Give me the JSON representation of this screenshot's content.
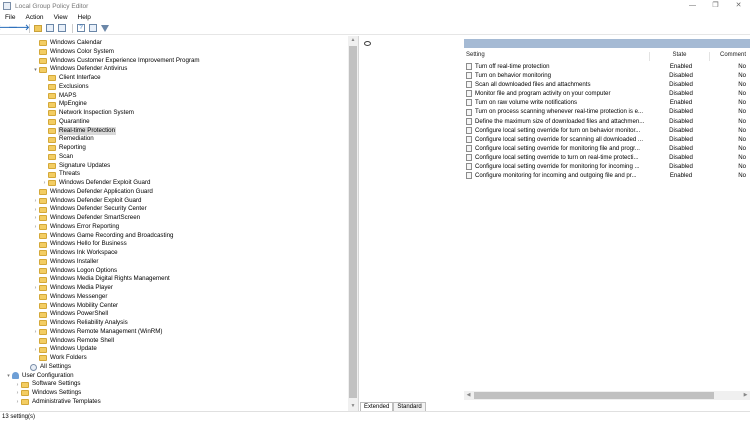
{
  "window": {
    "title": "Local Group Policy Editor",
    "controls": [
      "—",
      "❐",
      "✕"
    ]
  },
  "menu": [
    "File",
    "Action",
    "View",
    "Help"
  ],
  "toolbar": {
    "back": "🡐",
    "forward": "🡒"
  },
  "tree": {
    "items": [
      {
        "label": "Windows Calendar",
        "depth": 3,
        "expander": ""
      },
      {
        "label": "Windows Color System",
        "depth": 3,
        "expander": ""
      },
      {
        "label": "Windows Customer Experience Improvement Program",
        "depth": 3,
        "expander": ""
      },
      {
        "label": "Windows Defender Antivirus",
        "depth": 3,
        "expander": "▾"
      },
      {
        "label": "Client Interface",
        "depth": 4,
        "expander": ""
      },
      {
        "label": "Exclusions",
        "depth": 4,
        "expander": ""
      },
      {
        "label": "MAPS",
        "depth": 4,
        "expander": ""
      },
      {
        "label": "MpEngine",
        "depth": 4,
        "expander": ""
      },
      {
        "label": "Network Inspection System",
        "depth": 4,
        "expander": ""
      },
      {
        "label": "Quarantine",
        "depth": 4,
        "expander": ""
      },
      {
        "label": "Real-time Protection",
        "depth": 4,
        "expander": "",
        "selected": true
      },
      {
        "label": "Remediation",
        "depth": 4,
        "expander": ""
      },
      {
        "label": "Reporting",
        "depth": 4,
        "expander": ""
      },
      {
        "label": "Scan",
        "depth": 4,
        "expander": ""
      },
      {
        "label": "Signature Updates",
        "depth": 4,
        "expander": ""
      },
      {
        "label": "Threats",
        "depth": 4,
        "expander": ""
      },
      {
        "label": "Windows Defender Exploit Guard",
        "depth": 4,
        "expander": "›"
      },
      {
        "label": "Windows Defender Application Guard",
        "depth": 3,
        "expander": ""
      },
      {
        "label": "Windows Defender Exploit Guard",
        "depth": 3,
        "expander": "›"
      },
      {
        "label": "Windows Defender Security Center",
        "depth": 3,
        "expander": "›"
      },
      {
        "label": "Windows Defender SmartScreen",
        "depth": 3,
        "expander": "›"
      },
      {
        "label": "Windows Error Reporting",
        "depth": 3,
        "expander": "›"
      },
      {
        "label": "Windows Game Recording and Broadcasting",
        "depth": 3,
        "expander": ""
      },
      {
        "label": "Windows Hello for Business",
        "depth": 3,
        "expander": ""
      },
      {
        "label": "Windows Ink Workspace",
        "depth": 3,
        "expander": ""
      },
      {
        "label": "Windows Installer",
        "depth": 3,
        "expander": ""
      },
      {
        "label": "Windows Logon Options",
        "depth": 3,
        "expander": ""
      },
      {
        "label": "Windows Media Digital Rights Management",
        "depth": 3,
        "expander": ""
      },
      {
        "label": "Windows Media Player",
        "depth": 3,
        "expander": "›"
      },
      {
        "label": "Windows Messenger",
        "depth": 3,
        "expander": ""
      },
      {
        "label": "Windows Mobility Center",
        "depth": 3,
        "expander": ""
      },
      {
        "label": "Windows PowerShell",
        "depth": 3,
        "expander": ""
      },
      {
        "label": "Windows Reliability Analysis",
        "depth": 3,
        "expander": ""
      },
      {
        "label": "Windows Remote Management (WinRM)",
        "depth": 3,
        "expander": "›"
      },
      {
        "label": "Windows Remote Shell",
        "depth": 3,
        "expander": ""
      },
      {
        "label": "Windows Update",
        "depth": 3,
        "expander": "›"
      },
      {
        "label": "Work Folders",
        "depth": 3,
        "expander": ""
      },
      {
        "label": "All Settings",
        "depth": 2,
        "expander": "",
        "icon": "settings"
      },
      {
        "label": "User Configuration",
        "depth": 0,
        "expander": "▾",
        "icon": "user"
      },
      {
        "label": "Software Settings",
        "depth": 1,
        "expander": "›"
      },
      {
        "label": "Windows Settings",
        "depth": 1,
        "expander": "›"
      },
      {
        "label": "Administrative Templates",
        "depth": 1,
        "expander": "›"
      }
    ]
  },
  "details": {
    "columns": {
      "setting": "Setting",
      "state": "State",
      "comment": "Comment"
    },
    "rows": [
      {
        "setting": "Turn off real-time protection",
        "state": "Enabled",
        "comment": "No"
      },
      {
        "setting": "Turn on behavior monitoring",
        "state": "Disabled",
        "comment": "No"
      },
      {
        "setting": "Scan all downloaded files and attachments",
        "state": "Disabled",
        "comment": "No"
      },
      {
        "setting": "Monitor file and program activity on your computer",
        "state": "Disabled",
        "comment": "No"
      },
      {
        "setting": "Turn on raw volume write notifications",
        "state": "Enabled",
        "comment": "No"
      },
      {
        "setting": "Turn on process scanning whenever real-time protection is e...",
        "state": "Disabled",
        "comment": "No"
      },
      {
        "setting": "Define the maximum size of downloaded files and attachmen...",
        "state": "Disabled",
        "comment": "No"
      },
      {
        "setting": "Configure local setting override for turn on behavior monitor...",
        "state": "Disabled",
        "comment": "No"
      },
      {
        "setting": "Configure local setting override for scanning all downloaded ...",
        "state": "Disabled",
        "comment": "No"
      },
      {
        "setting": "Configure local setting override for monitoring file and progr...",
        "state": "Disabled",
        "comment": "No"
      },
      {
        "setting": "Configure local setting override to turn on real-time protecti...",
        "state": "Disabled",
        "comment": "No"
      },
      {
        "setting": "Configure local setting override for monitoring for incoming ...",
        "state": "Disabled",
        "comment": "No"
      },
      {
        "setting": "Configure monitoring for incoming and outgoing file and pr...",
        "state": "Enabled",
        "comment": "No"
      }
    ]
  },
  "tabs": [
    "Extended",
    "Standard"
  ],
  "status": "13 setting(s)",
  "colors": {
    "header_bar": "#a5bad4",
    "folder": "#f3cd63",
    "selected": "#d9d9d9"
  }
}
